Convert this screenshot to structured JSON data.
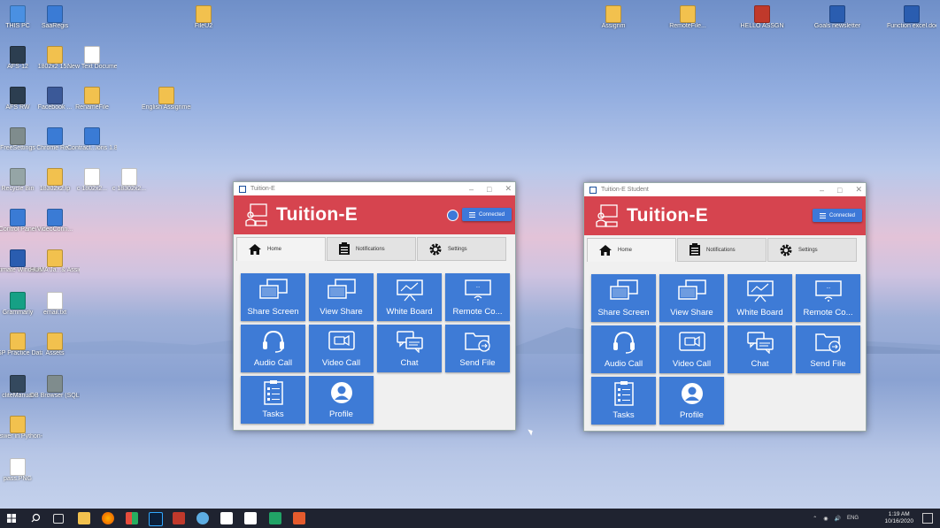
{
  "desktop": {
    "icons": [
      {
        "label": "THIS PC",
        "color": "#4a90e2",
        "icon": "computer-icon"
      },
      {
        "label": "SaaRegis",
        "color": "#3a7bd5",
        "icon": "app-icon"
      },
      {
        "label": "FileU2",
        "color": "#f2c14e",
        "icon": "folder-icon"
      },
      {
        "label": "Assignm",
        "color": "#f2c14e",
        "icon": "folder-icon"
      },
      {
        "label": "RemoteFile...",
        "color": "#f2c14e",
        "icon": "folder-icon"
      },
      {
        "label": "HELLO ASSGN",
        "color": "#c0392b",
        "icon": "pdf-icon"
      },
      {
        "label": "Goals newsletter",
        "color": "#2a5db0",
        "icon": "word-icon"
      },
      {
        "label": "Function excel.docx",
        "color": "#2a5db0",
        "icon": "word-icon"
      },
      {
        "label": "AFS-12",
        "color": "#2c3e50",
        "icon": "app-icon"
      },
      {
        "label": "1802x2 15...",
        "color": "#f2c14e",
        "icon": "folder-icon"
      },
      {
        "label": "New Text Documen...",
        "color": "#ffffff",
        "icon": "text-file-icon"
      },
      {
        "label": "AFS RW",
        "color": "#2c3e50",
        "icon": "app-icon"
      },
      {
        "label": "Facebook ...",
        "color": "#3b5998",
        "icon": "app-icon"
      },
      {
        "label": "RenameFile",
        "color": "#f2c14e",
        "icon": "folder-icon"
      },
      {
        "label": "English Assignment",
        "color": "#f2c14e",
        "icon": "folder-icon"
      },
      {
        "label": "FreeSettings",
        "color": "#7f8c8d",
        "icon": "settings-icon"
      },
      {
        "label": "Chrome Re...",
        "color": "#3a7bd5",
        "icon": "python-icon"
      },
      {
        "label": "Contract...ions 1.82x",
        "color": "#3a7bd5",
        "icon": "python-icon"
      },
      {
        "label": "Recycle Bin",
        "color": "#95a5a6",
        "icon": "recycle-bin-icon"
      },
      {
        "label": "18302x2.lp",
        "color": "#f2c14e",
        "icon": "folder-icon"
      },
      {
        "label": "c 1802x2...",
        "color": "#ffffff",
        "icon": "text-file-icon"
      },
      {
        "label": "c 18302x2...",
        "color": "#ffffff",
        "icon": "text-file-icon"
      },
      {
        "label": "Control Panel",
        "color": "#3a7bd5",
        "icon": "control-panel-icon"
      },
      {
        "label": "VideoConn...",
        "color": "#3a7bd5",
        "icon": "python-icon"
      },
      {
        "label": "Ultimate Windows",
        "color": "#2a5db0",
        "icon": "app-icon"
      },
      {
        "label": "HUMA Ja...& Assignment...",
        "color": "#f2c14e",
        "icon": "folder-icon"
      },
      {
        "label": "Grammarly",
        "color": "#16a085",
        "icon": "grammarly-icon"
      },
      {
        "label": "email.txt",
        "color": "#ffffff",
        "icon": "text-file-icon"
      },
      {
        "label": "CSP Practice Data",
        "color": "#f2c14e",
        "icon": "folder-icon"
      },
      {
        "label": "Assets",
        "color": "#f2c14e",
        "icon": "folder-icon"
      },
      {
        "label": "cliteManual",
        "color": "#34495e",
        "icon": "app-icon"
      },
      {
        "label": "DB Browser (SQLite)",
        "color": "#7f8c8d",
        "icon": "database-icon"
      },
      {
        "label": "answer in Python-Exercises",
        "color": "#f2c14e",
        "icon": "folder-icon"
      },
      {
        "label": "pass.PNG",
        "color": "#ffffff",
        "icon": "image-file-icon"
      }
    ]
  },
  "windows": [
    {
      "title": "Tuition-E",
      "app_name": "Tuition-E",
      "status_button": "Connected",
      "tabs": [
        "Home",
        "Notifications",
        "Settings"
      ],
      "tiles": [
        "Share Screen",
        "View Share",
        "White Board",
        "Remote Co...",
        "Audio Call",
        "Video Call",
        "Chat",
        "Send File",
        "Tasks",
        "Profile"
      ]
    },
    {
      "title": "Tuition-E Student",
      "app_name": "Tuition-E",
      "status_button": "Connected",
      "tabs": [
        "Home",
        "Notifications",
        "Settings"
      ],
      "tiles": [
        "Share Screen",
        "View Share",
        "White Board",
        "Remote Co...",
        "Audio Call",
        "Video Call",
        "Chat",
        "Send File",
        "Tasks",
        "Profile"
      ]
    }
  ],
  "taskbar": {
    "language": "ENG",
    "time": "1:19 AM",
    "date": "10/16/2020"
  },
  "colors": {
    "header_red": "#d6444f",
    "tile_blue": "#3e7bd6",
    "taskbar": "#1f2330"
  }
}
